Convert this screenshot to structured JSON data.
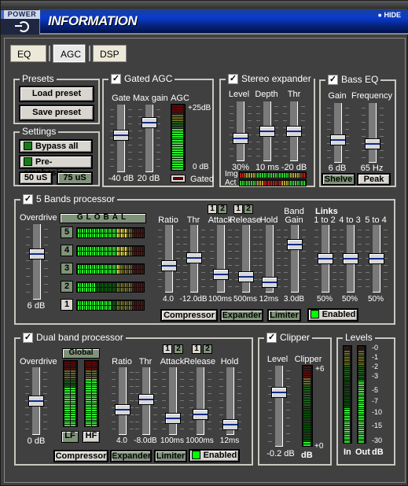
{
  "titlebar": {
    "power_label": "POWER",
    "title": "INFORMATION",
    "hide_label": "HIDE"
  },
  "tabs": [
    {
      "label": "EQ",
      "active": false
    },
    {
      "label": "AGC",
      "active": true
    },
    {
      "label": "DSP",
      "active": false
    }
  ],
  "presets": {
    "title": "Presets",
    "load": "Load preset",
    "save": "Save preset"
  },
  "settings": {
    "title": "Settings",
    "bypass": "Bypass all",
    "preemphasis": "Pre-emphasis",
    "opt50": "50 uS",
    "opt75": "75 uS",
    "selected": "75 uS"
  },
  "gated_agc": {
    "title": "Gated AGC",
    "checked": true,
    "gate": {
      "label": "Gate",
      "value": "-40 dB",
      "level": 0.55
    },
    "maxgain": {
      "label": "Max gain",
      "value": "20 dB",
      "level": 0.78
    },
    "agc": {
      "label": "AGC",
      "top": "+25dB",
      "bottom": "0 dB",
      "level": 0.62
    },
    "gated_label": "Gated"
  },
  "stereo": {
    "title": "Stereo expander",
    "checked": true,
    "level": {
      "label": "Level",
      "value": "30%",
      "level": 0.35
    },
    "depth": {
      "label": "Depth",
      "value": "10 ms",
      "level": 0.5
    },
    "thr": {
      "label": "Thr",
      "value": "-20 dB",
      "level": 0.5
    },
    "img_label": "Img",
    "act_label": "Act"
  },
  "bass": {
    "title": "Bass EQ",
    "checked": true,
    "gain": {
      "label": "Gain",
      "value": "6 dB",
      "level": 0.35
    },
    "freq": {
      "label": "Frequency",
      "value": "65 Hz",
      "level": 0.27
    },
    "shelve": "Shelve",
    "peak": "Peak",
    "selected": "Peak"
  },
  "five": {
    "title": "5 Bands processor",
    "checked": true,
    "global": "GLOBAL",
    "overdrive": {
      "label": "Overdrive",
      "value": "6 dB",
      "level": 0.62
    },
    "bands": [
      {
        "n": "5",
        "level": 0.72
      },
      {
        "n": "4",
        "level": 0.73
      },
      {
        "n": "3",
        "level": 0.62
      },
      {
        "n": "2",
        "level": 0.25
      },
      {
        "n": "1",
        "level": 0.48,
        "selected": true
      }
    ],
    "sliders": [
      {
        "label": "Ratio",
        "value": "4.0",
        "level": 0.38
      },
      {
        "label": "Thr",
        "value": "-12.0dB",
        "level": 0.52
      },
      {
        "label": "Attack",
        "value": "100ms",
        "level": 0.22
      },
      {
        "label": "Release",
        "value": "500ms",
        "level": 0.18
      },
      {
        "label": "Hold",
        "value": "12ms",
        "level": 0.08
      },
      {
        "label": "Band Gain",
        "value": "3.0dB",
        "level": 0.75
      },
      {
        "label": "1 to 2",
        "value": "50%",
        "level": 0.5
      },
      {
        "label": "4 to 3",
        "value": "50%",
        "level": 0.5
      },
      {
        "label": "5 to 4",
        "value": "50%",
        "level": 0.5
      }
    ],
    "links_label": "Links",
    "band_label": "Band",
    "gain_label": "Gain",
    "one": "1",
    "two": "2",
    "compressor": "Compressor",
    "expander": "Expander",
    "limiter": "Limiter",
    "enabled": "Enabled"
  },
  "dual": {
    "title": "Dual band processor",
    "checked": true,
    "global": "Global",
    "lf": "LF",
    "hf": "HF",
    "overdrive": {
      "label": "Overdrive",
      "value": "0 dB",
      "level": 0.5
    },
    "sliders": [
      {
        "label": "Ratio",
        "value": "4.0",
        "level": 0.35
      },
      {
        "label": "Thr",
        "value": "-8.0dB",
        "level": 0.53
      },
      {
        "label": "Attack",
        "value": "100ms",
        "level": 0.2
      },
      {
        "label": "Release",
        "value": "1000ms",
        "level": 0.26
      },
      {
        "label": "Hold",
        "value": "12ms",
        "level": 0.08
      }
    ],
    "one": "1",
    "two": "2",
    "compressor": "Compressor",
    "expander": "Expander",
    "limiter": "Limiter",
    "enabled": "Enabled",
    "lf_level": 0.6,
    "hf_level": 0.73
  },
  "clipper": {
    "title": "Clipper",
    "checked": true,
    "level": {
      "label": "Level",
      "value": "-0.2 dB",
      "level": 0.7
    },
    "meter_label": "Clipper",
    "top": "+6",
    "bottom": "+0",
    "unit": "dB",
    "meter_level": 0.03
  },
  "levels": {
    "title": "Levels",
    "scale": [
      "-0",
      "-1",
      "-2",
      "-3",
      "-5",
      "-7",
      "-10",
      "-15",
      "-30"
    ],
    "in_label": "In",
    "out_label": "Out",
    "unit": "dB",
    "in_level": 0.36,
    "out_level": 0.65
  }
}
